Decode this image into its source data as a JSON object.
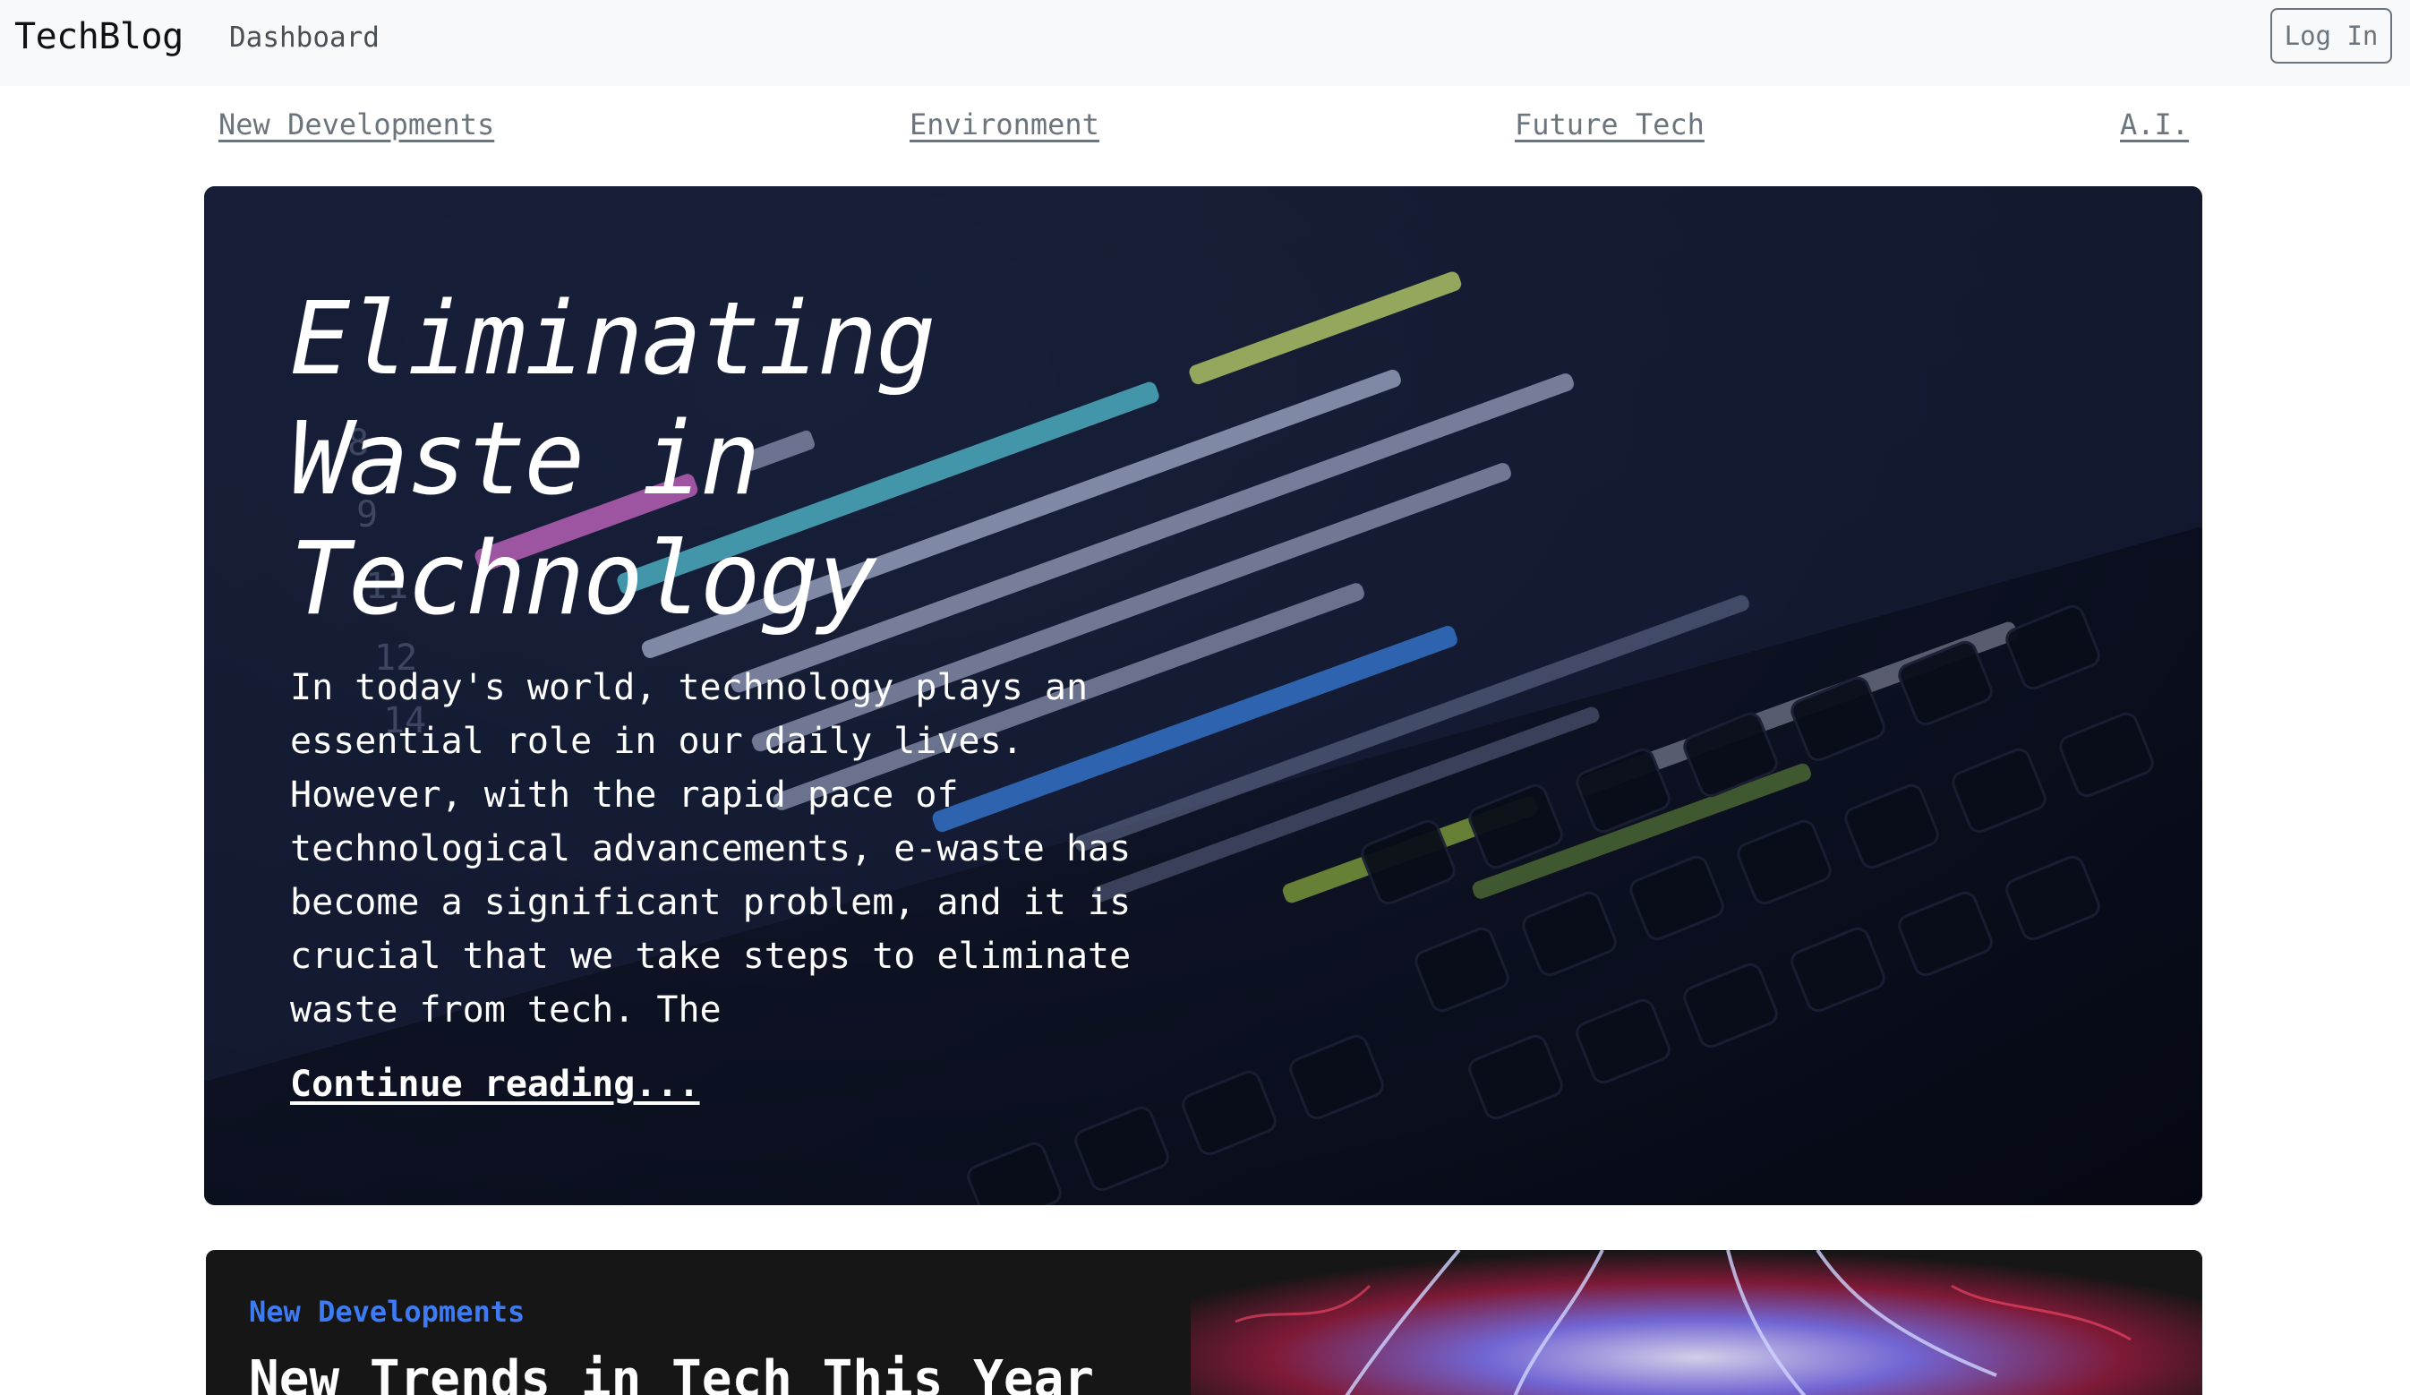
{
  "header": {
    "brand": "TechBlog",
    "nav_dashboard": "Dashboard",
    "login_label": "Log In"
  },
  "categories": [
    {
      "label": "New Developments"
    },
    {
      "label": "Environment"
    },
    {
      "label": "Future Tech"
    },
    {
      "label": "A.I."
    }
  ],
  "featured": {
    "title": "Eliminating Waste in Technology",
    "excerpt": "In today's world, technology plays an essential role in our daily lives. However, with the rapid pace of technological advancements, e-waste has become a significant problem, and it is crucial that we take steps to eliminate waste from tech. The",
    "link_label": "Continue reading..."
  },
  "post": {
    "category": "New Developments",
    "title": "New Trends in Tech This Year",
    "category_color": "#3d7bf5"
  },
  "icons": {
    "hero_image": "code-on-laptop-photo",
    "card_image": "plasma-ball-photo"
  }
}
